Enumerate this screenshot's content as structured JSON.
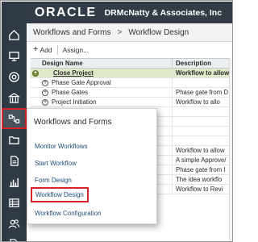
{
  "header": {
    "logo": "ORACLE",
    "org": "DRMcNatty & Associates, Inc"
  },
  "breadcrumb": {
    "first": "Workflows and Forms",
    "separator": ">",
    "current": "Workflow Design"
  },
  "toolbar": {
    "add_icon": "+",
    "add_label": "Add",
    "assign_label": "Assign..."
  },
  "table": {
    "headers": [
      "Design Name",
      "Description"
    ],
    "rows": [
      {
        "name": "Close Project",
        "description": "Workflow to allow",
        "selected": true
      },
      {
        "name": "Phase Gate Approval",
        "description": "",
        "selected": false
      },
      {
        "name": "Phase Gates",
        "description": "Phase gate from D",
        "selected": false
      },
      {
        "name": "Project Initiation",
        "description": "Workflow to allo",
        "selected": false
      },
      {
        "name": "",
        "description": "",
        "selected": false
      },
      {
        "name": "",
        "description": "",
        "selected": false
      },
      {
        "name": "",
        "description": "",
        "selected": false
      },
      {
        "name": "",
        "description": "",
        "selected": false
      },
      {
        "name": "",
        "description": "Workflow to allow",
        "selected": false
      },
      {
        "name": "",
        "description": "A simple Approve/",
        "selected": false
      },
      {
        "name": "",
        "description": "Phase gate from I",
        "selected": false
      },
      {
        "name": "",
        "description": "The idea workflo",
        "selected": false
      },
      {
        "name": "",
        "description": "Workflow to Revi",
        "selected": false
      }
    ]
  },
  "popup": {
    "title": "Workflows and Forms",
    "items": [
      {
        "label": "Monitor Workflows",
        "highlighted": false
      },
      {
        "label": "Start Workflow",
        "highlighted": false
      },
      {
        "label": "Form Design",
        "highlighted": false
      },
      {
        "label": "Workflow Design",
        "highlighted": true
      },
      {
        "label": "Workflow Configuration",
        "highlighted": false
      }
    ]
  },
  "nav_icons": [
    "home-icon",
    "monitor-icon",
    "target-icon",
    "building-icon",
    "workflow-icon",
    "folder-icon",
    "document-icon",
    "chart-icon",
    "table-icon",
    "users-icon",
    "tag-icon"
  ],
  "colors": {
    "rail": "#2f3a45",
    "header": "#333c45",
    "selected_row": "#dfe8c8",
    "highlight": "#d8242b",
    "link": "#1f4d7a"
  }
}
